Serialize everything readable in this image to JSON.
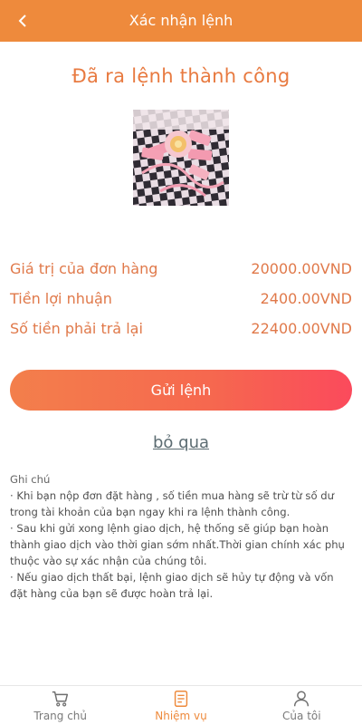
{
  "header": {
    "title": "Xác nhận lệnh",
    "back_icon": "chevron-left-icon"
  },
  "confirmation": {
    "title": "Đã ra lệnh thành công"
  },
  "summary": [
    {
      "label": "Giá trị của đơn hàng",
      "value": "20000.00VND"
    },
    {
      "label": "Tiền lợi nhuận",
      "value": "2400.00VND"
    },
    {
      "label": "Số tiền phải trả lại",
      "value": "22400.00VND"
    }
  ],
  "actions": {
    "submit_label": "Gửi lệnh",
    "skip_label": "bỏ qua"
  },
  "notes": {
    "heading": "Ghi chú",
    "items": [
      "· Khi bạn nộp đơn đặt hàng , số tiền mua hàng sẽ trừ từ số dư trong tài khoản của bạn ngay khi ra lệnh thành công.",
      "· Sau khi gửi xong lệnh giao dịch, hệ thống sẽ giúp bạn hoàn thành giao dịch vào thời gian sớm nhất.Thời gian chính xác phụ thuộc vào sự xác nhận của chúng tôi.",
      "· Nếu giao dịch thất bại, lệnh giao dịch sẽ hủy tự động và vốn đặt hàng của bạn sẽ được hoàn trả lại."
    ]
  },
  "bottom_nav": [
    {
      "label": "Trang chủ",
      "icon": "cart-icon",
      "active": false
    },
    {
      "label": "Nhiệm vụ",
      "icon": "document-icon",
      "active": true
    },
    {
      "label": "Của tôi",
      "icon": "user-icon",
      "active": false
    }
  ],
  "colors": {
    "accent": "#ee8a3c",
    "value_text": "#e0794a",
    "button_start": "#f37f4b",
    "button_end": "#fb4a5c"
  }
}
